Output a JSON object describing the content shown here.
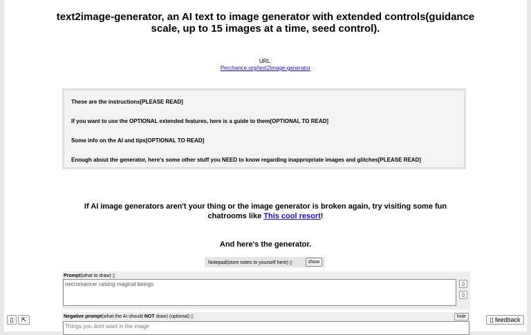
{
  "header": {
    "title": "text2image-generator, an AI text to image generator with extended controls(guidance scale, up to 15 images at a time, seed control).",
    "url_label": "URL:",
    "url_link": "Perchance.org/text2image-generator"
  },
  "details": [
    "These are the instructions[PLEASE READ]",
    "If you want to use the OPTIONAL extended features, here is a guide to them[OPTIONAL TO READ]",
    "Some info on the AI and tips[OPTIONAL TO READ]",
    "Enough about the generator, here's some other stuff you NEED to know regarding inappropriate images and glitches[PLEASE READ]"
  ],
  "promo": {
    "text_before": "If AI image generators aren't your thing or the image generator is broken again, try visiting some fun chatrooms like ",
    "link_text": "This cool resort",
    "text_after": "!"
  },
  "generator_heading": "And here's the generator.",
  "notepad": {
    "label": "Notepad(store notes to yourself here) ▯",
    "button": "show"
  },
  "prompt": {
    "label_bold": "Prompt",
    "label_rest": "(what to draw) ▯",
    "value": "necromancer raising magical beings",
    "btn1": "▯",
    "btn2": "▯"
  },
  "negative_prompt": {
    "label_bold1": "Negative prompt",
    "label_mid": "(what the AI should ",
    "label_bold2": "NOT",
    "label_rest": " draw) (optional) ▯",
    "placeholder": "Things you dont want in the image",
    "hide_button": "hide"
  },
  "corner": {
    "left_btn1": "▯",
    "left_btn2": "⇱",
    "feedback": "▯ feedback"
  }
}
